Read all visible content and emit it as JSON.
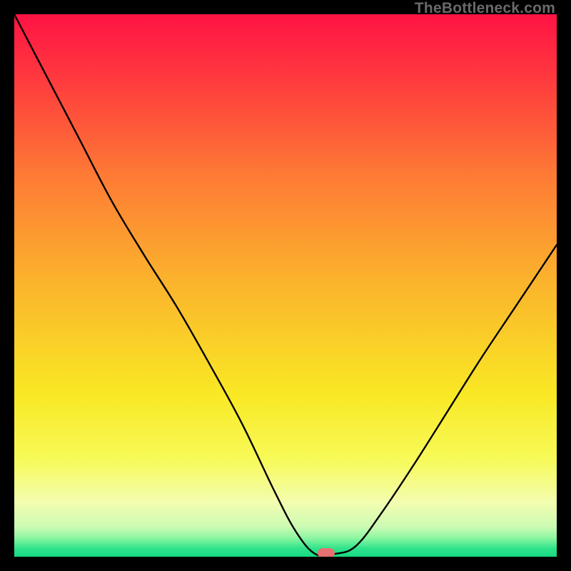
{
  "watermark": "TheBottleneck.com",
  "colors": {
    "frame": "#000000",
    "gradient_stops": [
      {
        "pos": 0.0,
        "color": "#FF1344"
      },
      {
        "pos": 0.12,
        "color": "#FF3A3E"
      },
      {
        "pos": 0.3,
        "color": "#FE7B35"
      },
      {
        "pos": 0.5,
        "color": "#FBB52C"
      },
      {
        "pos": 0.7,
        "color": "#F9E824"
      },
      {
        "pos": 0.82,
        "color": "#F7FA58"
      },
      {
        "pos": 0.9,
        "color": "#F3FDB0"
      },
      {
        "pos": 0.945,
        "color": "#CBFBB3"
      },
      {
        "pos": 0.965,
        "color": "#8EF6A2"
      },
      {
        "pos": 0.985,
        "color": "#2EE38B"
      },
      {
        "pos": 1.0,
        "color": "#16D983"
      }
    ],
    "curve": "#000000",
    "marker": "#e77070"
  },
  "chart_data": {
    "type": "line",
    "title": "",
    "xlabel": "",
    "ylabel": "",
    "xlim": [
      0,
      1
    ],
    "ylim": [
      0,
      1
    ],
    "x": [
      0.0,
      0.06,
      0.12,
      0.18,
      0.24,
      0.3,
      0.36,
      0.42,
      0.48,
      0.52,
      0.555,
      0.59,
      0.63,
      0.68,
      0.74,
      0.8,
      0.86,
      0.92,
      1.0
    ],
    "values": [
      1.0,
      0.885,
      0.77,
      0.655,
      0.555,
      0.46,
      0.355,
      0.245,
      0.12,
      0.045,
      0.005,
      0.005,
      0.02,
      0.085,
      0.175,
      0.27,
      0.365,
      0.455,
      0.575
    ],
    "flat_bottom": {
      "x_start": 0.555,
      "x_end": 0.59,
      "y": 0.005
    },
    "marker": {
      "x": 0.575,
      "y": 0.007
    }
  }
}
